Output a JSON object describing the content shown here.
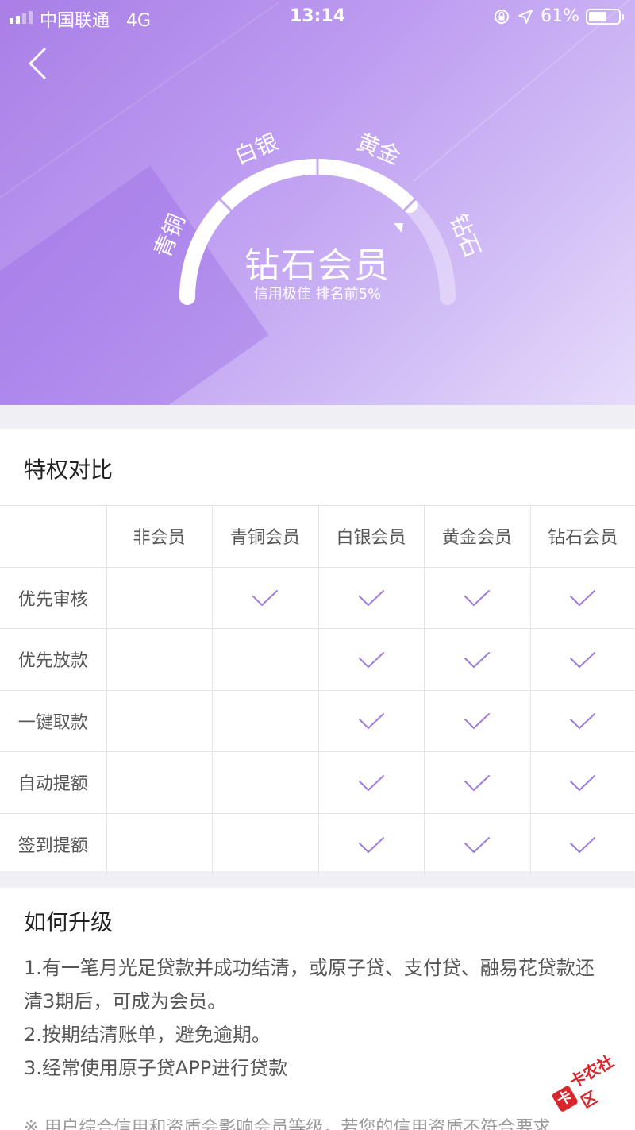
{
  "status_bar": {
    "carrier": "中国联通",
    "network": "4G",
    "time": "13:14",
    "battery": "61%",
    "battery_level": 0.61
  },
  "hero": {
    "title": "钻石会员",
    "subtitle": "信用极佳  排名前5%",
    "levels": [
      "青铜",
      "白银",
      "黄金",
      "钻石"
    ],
    "current_level": "钻石"
  },
  "comparison": {
    "title": "特权对比",
    "columns": [
      "",
      "非会员",
      "青铜会员",
      "白银会员",
      "黄金会员",
      "钻石会员"
    ],
    "rows": [
      {
        "label": "优先审核",
        "checks": [
          false,
          true,
          true,
          true,
          true
        ]
      },
      {
        "label": "优先放款",
        "checks": [
          false,
          false,
          true,
          true,
          true
        ]
      },
      {
        "label": "一键取款",
        "checks": [
          false,
          false,
          true,
          true,
          true
        ]
      },
      {
        "label": "自动提额",
        "checks": [
          false,
          false,
          true,
          true,
          true
        ]
      },
      {
        "label": "签到提额",
        "checks": [
          false,
          false,
          true,
          true,
          true
        ]
      }
    ]
  },
  "upgrade": {
    "title": "如何升级",
    "items": [
      "1.有一笔月光足贷款并成功结清，或原子贷、支付贷、融易花贷款还清3期后，可成为会员。",
      "2.按期结清账单，避免逾期。",
      "3.经常使用原子贷APP进行贷款"
    ],
    "note": "※ 用户综合信用和资质会影响会员等级，若您的信用资质不符合要求"
  },
  "watermark": {
    "text": "卡农社区",
    "logo": "卡"
  },
  "colors": {
    "accent": "#9f7ce0",
    "gradient_start": "#a97ee6",
    "gradient_end": "#e6dcfb",
    "watermark": "#d8262d"
  }
}
